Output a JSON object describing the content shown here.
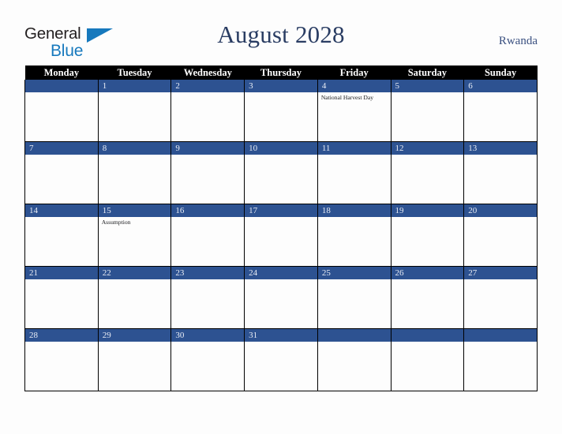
{
  "brand": {
    "line1": "General",
    "line2": "Blue",
    "triangle_color": "#1779bd",
    "text_color": "#231f20"
  },
  "header": {
    "title": "August 2028",
    "country": "Rwanda",
    "title_color": "#2a3d63"
  },
  "theme": {
    "header_row_bg": "#000000",
    "header_row_text": "#ffffff",
    "day_bar_bg": "#2d5291",
    "day_bar_text": "#e9edf5",
    "cell_bg": "#fdfdfd",
    "grid_line": "#000000",
    "page_bg": "#fdfdfd"
  },
  "weekdays": [
    "Monday",
    "Tuesday",
    "Wednesday",
    "Thursday",
    "Friday",
    "Saturday",
    "Sunday"
  ],
  "weeks": [
    [
      {
        "date": "",
        "event": ""
      },
      {
        "date": "1",
        "event": ""
      },
      {
        "date": "2",
        "event": ""
      },
      {
        "date": "3",
        "event": ""
      },
      {
        "date": "4",
        "event": "National Harvest Day"
      },
      {
        "date": "5",
        "event": ""
      },
      {
        "date": "6",
        "event": ""
      }
    ],
    [
      {
        "date": "7",
        "event": ""
      },
      {
        "date": "8",
        "event": ""
      },
      {
        "date": "9",
        "event": ""
      },
      {
        "date": "10",
        "event": ""
      },
      {
        "date": "11",
        "event": ""
      },
      {
        "date": "12",
        "event": ""
      },
      {
        "date": "13",
        "event": ""
      }
    ],
    [
      {
        "date": "14",
        "event": ""
      },
      {
        "date": "15",
        "event": "Assumption"
      },
      {
        "date": "16",
        "event": ""
      },
      {
        "date": "17",
        "event": ""
      },
      {
        "date": "18",
        "event": ""
      },
      {
        "date": "19",
        "event": ""
      },
      {
        "date": "20",
        "event": ""
      }
    ],
    [
      {
        "date": "21",
        "event": ""
      },
      {
        "date": "22",
        "event": ""
      },
      {
        "date": "23",
        "event": ""
      },
      {
        "date": "24",
        "event": ""
      },
      {
        "date": "25",
        "event": ""
      },
      {
        "date": "26",
        "event": ""
      },
      {
        "date": "27",
        "event": ""
      }
    ],
    [
      {
        "date": "28",
        "event": ""
      },
      {
        "date": "29",
        "event": ""
      },
      {
        "date": "30",
        "event": ""
      },
      {
        "date": "31",
        "event": ""
      },
      {
        "date": "",
        "event": ""
      },
      {
        "date": "",
        "event": ""
      },
      {
        "date": "",
        "event": ""
      }
    ]
  ]
}
